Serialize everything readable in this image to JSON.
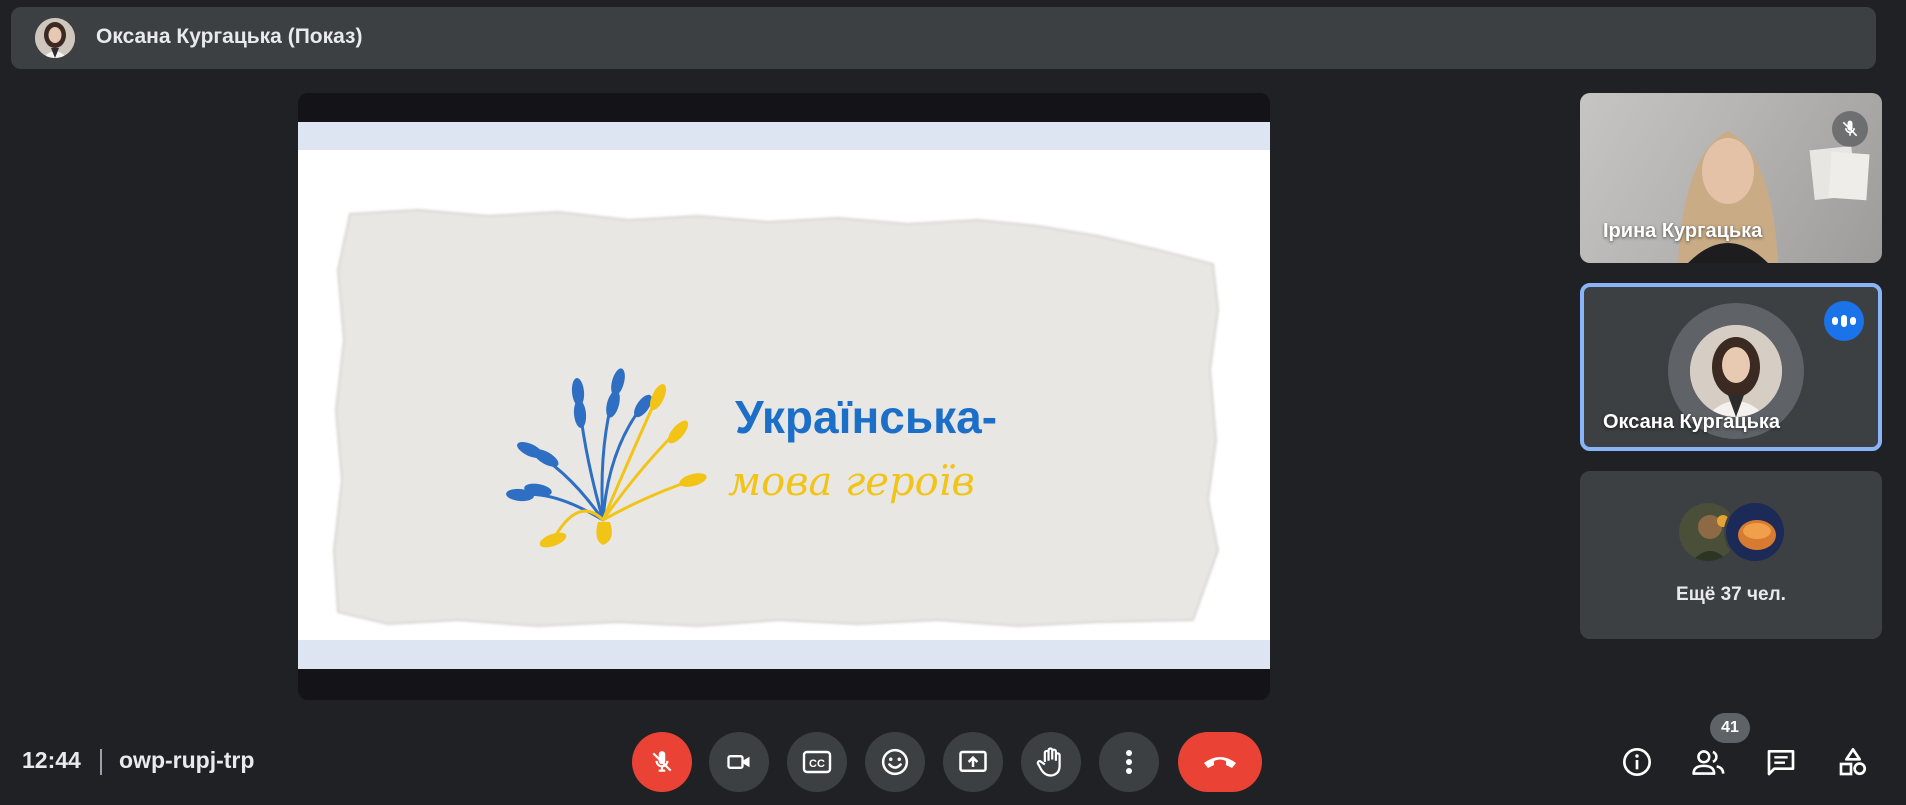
{
  "presenter": {
    "name": "Оксана Кургацька (Показ)"
  },
  "slide": {
    "title_line1": "Українська-",
    "title_line2": "мова героїв",
    "colors": {
      "blue": "#1c6fc9",
      "yellow": "#f2c418"
    }
  },
  "tiles": [
    {
      "name": "Ірина Кургацька",
      "status": "muted"
    },
    {
      "name": "Оксана Кургацька",
      "status": "speaking"
    }
  ],
  "more": {
    "label": "Ещё 37 чел."
  },
  "footer": {
    "time": "12:44",
    "meeting_code": "owp-rupj-trp",
    "participant_count": "41"
  },
  "controls": {
    "mic": {
      "icon": "mic-off-icon",
      "state": "off"
    },
    "camera": {
      "icon": "video-camera-icon"
    },
    "captions": {
      "icon": "closed-captions-icon",
      "label": "CC"
    },
    "reactions": {
      "icon": "emoji-icon"
    },
    "present": {
      "icon": "present-screen-icon"
    },
    "raise_hand": {
      "icon": "hand-icon"
    },
    "more": {
      "icon": "more-vert-icon"
    },
    "hangup": {
      "icon": "phone-hangup-icon"
    }
  },
  "accent_colors": {
    "red": "#ea4335",
    "speaking_blue": "#1a73e8",
    "active_border": "#8ab4f8"
  }
}
